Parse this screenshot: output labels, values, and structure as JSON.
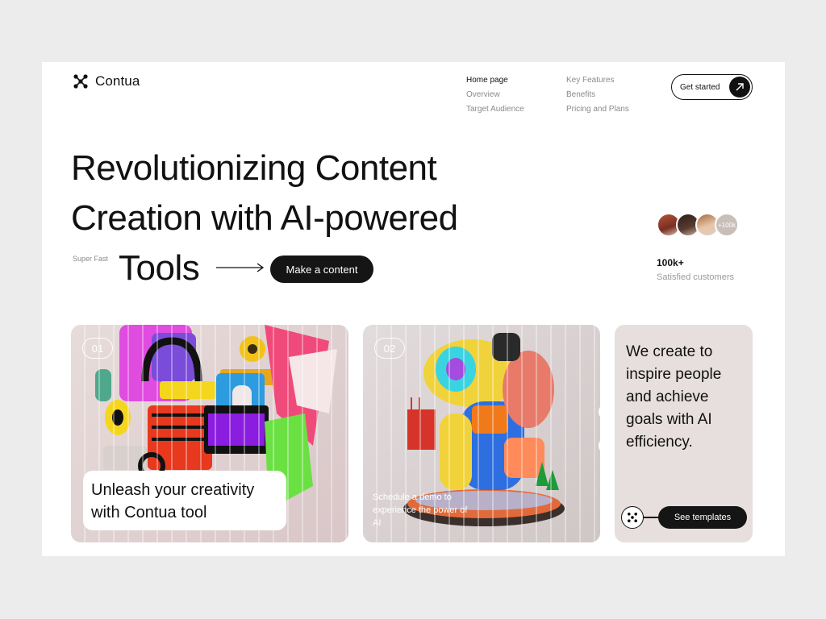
{
  "brand": {
    "name": "Contua"
  },
  "nav": {
    "col1": [
      "Home  page",
      "Overview",
      "Target Audience"
    ],
    "col2": [
      "Key Features",
      "Benefits",
      "Pricing and Plans"
    ]
  },
  "header": {
    "cta_label": "Get started"
  },
  "hero": {
    "line1": "Revolutionizing Content",
    "line2": "Creation with AI-powered",
    "line3": "Tools",
    "tag": "Super Fast",
    "cta_label": "Make a content"
  },
  "social_proof": {
    "more_label": "+100k",
    "count": "100k+",
    "label": "Satisfied customers"
  },
  "cards": {
    "card1": {
      "number": "01",
      "caption": "Unleash your creativity with Contua tool"
    },
    "card2": {
      "number": "02",
      "caption": "Schedule a demo to experience the power of AI"
    },
    "card3": {
      "text": "We create to inspire people and achieve goals with AI efficiency.",
      "cta_label": "See templates"
    }
  },
  "colors": {
    "accent_dark": "#151515",
    "muted_text": "#8a8a8a",
    "card_bg": "#e6dfdd"
  }
}
